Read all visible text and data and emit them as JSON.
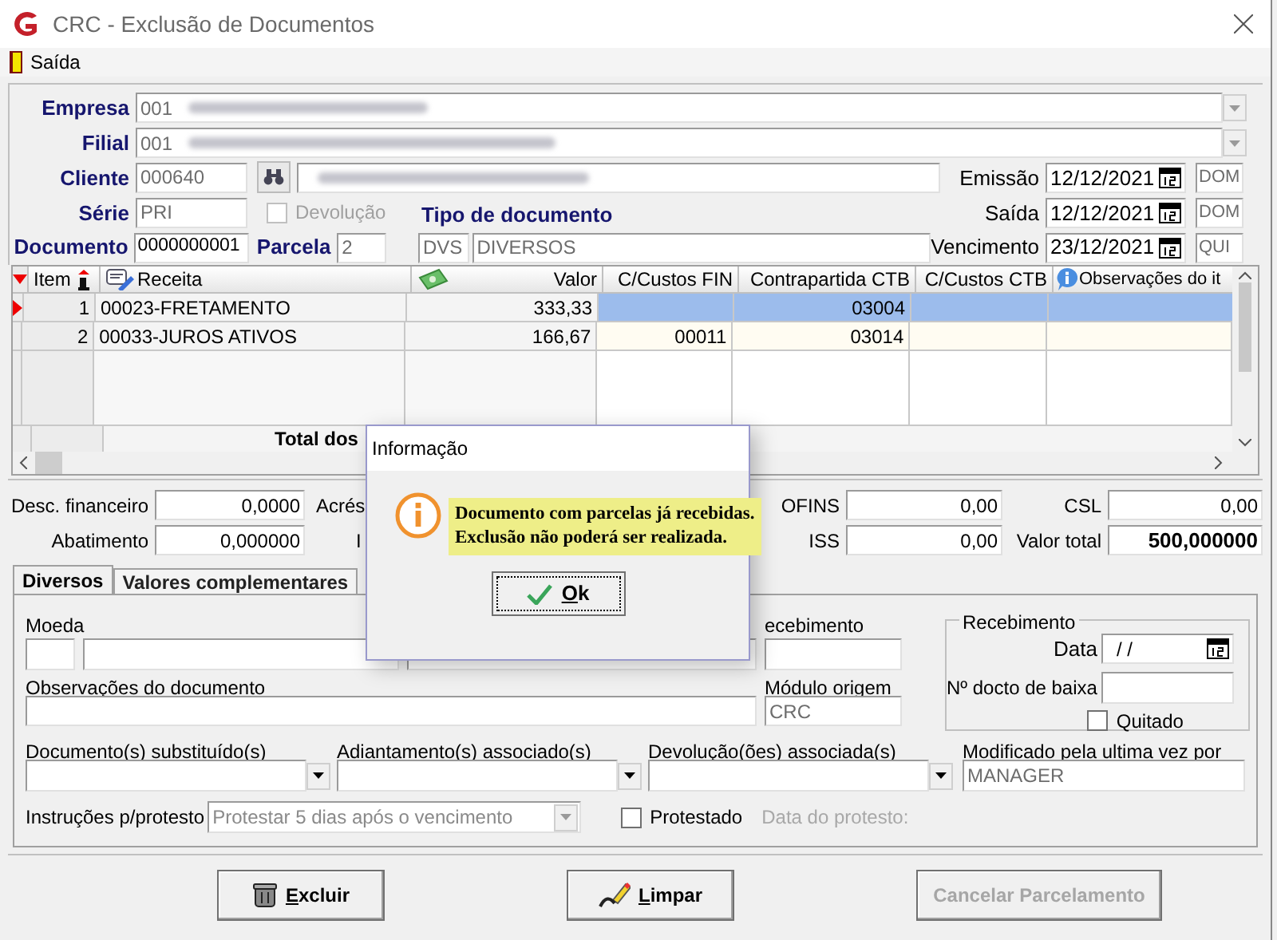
{
  "window": {
    "title": "CRC - Exclusão de Documentos"
  },
  "menu": [
    {
      "label": "Saída"
    }
  ],
  "header": {
    "empresa": {
      "label": "Empresa",
      "code": "001"
    },
    "filial": {
      "label": "Filial",
      "code": "001"
    },
    "cliente": {
      "label": "Cliente",
      "code": "000640"
    },
    "serie": {
      "label": "Série",
      "value": "PRI"
    },
    "devolucao": {
      "label": "Devolução",
      "checked": false,
      "disabled": true
    },
    "tipo_documento": {
      "label": "Tipo de documento",
      "code": "DVS",
      "name": "DIVERSOS"
    },
    "documento": {
      "label": "Documento",
      "value": "0000000001"
    },
    "parcela": {
      "label": "Parcela",
      "value": "2"
    },
    "dates": [
      {
        "label": "Emissão",
        "value": "12/12/2021",
        "day": "DOM"
      },
      {
        "label": "Saída",
        "value": "12/12/2021",
        "day": "DOM"
      },
      {
        "label": "Vencimento",
        "value": "23/12/2021",
        "day": "QUI"
      }
    ]
  },
  "grid": {
    "columns": [
      {
        "label": "Item"
      },
      {
        "label": "Receita"
      },
      {
        "label": "Valor"
      },
      {
        "label": "C/Custos FIN"
      },
      {
        "label": "Contrapartida CTB"
      },
      {
        "label": "C/Custos CTB"
      },
      {
        "label": "Observações do it"
      }
    ],
    "rows": [
      {
        "selected": true,
        "cells": [
          "1",
          "00023-FRETAMENTO",
          "333,33",
          null,
          "03004",
          null,
          null
        ]
      },
      {
        "selected": false,
        "cells": [
          "2",
          "00033-JUROS ATIVOS",
          "166,67",
          "00011",
          "03014",
          null,
          null
        ]
      }
    ],
    "total_label": "Total dos"
  },
  "totals": [
    [
      {
        "label": "Desc. financeiro",
        "value": "0,0000"
      },
      {
        "label": "Acrés"
      },
      {
        "label": "OFINS",
        "value": "0,00"
      },
      {
        "label": "CSL",
        "value": "0,00"
      }
    ],
    [
      {
        "label": "Abatimento",
        "value": "0,000000"
      },
      {
        "label": "I"
      },
      {
        "label": "ISS",
        "value": "0,00"
      },
      {
        "label": "Valor total",
        "value": "500,000000",
        "emphasis": true
      }
    ]
  ],
  "tabs": [
    {
      "label": "Diversos",
      "selected": true
    },
    {
      "label": "Valores complementares",
      "selected": false
    }
  ],
  "diversos": {
    "moeda": {
      "label": "Moeda"
    },
    "recebimento_field": {
      "label": "ecebimento"
    },
    "observacoes": {
      "label": "Observações do documento"
    },
    "modulo_origem": {
      "label": "Módulo origem",
      "value": "CRC"
    },
    "recebimento": {
      "title": "Recebimento",
      "data": {
        "label": "Data",
        "value": "/ /"
      },
      "nr_docto": {
        "label": "Nº docto de baixa"
      },
      "quitado": {
        "label": "Quitado",
        "checked": false
      }
    },
    "combos": [
      {
        "label": "Documento(s) substituído(s)"
      },
      {
        "label": "Adiantamento(s) associado(s)"
      },
      {
        "label": "Devolução(ões) associada(s)"
      }
    ],
    "modificado": {
      "label": "Modificado pela ultima vez por",
      "value": "MANAGER"
    },
    "instrucoes": {
      "label": "Instruções p/protesto",
      "value": "Protestar 5 dias após o vencimento",
      "disabled": true
    },
    "protestado": {
      "label": "Protestado",
      "checked": false
    },
    "data_protesto": {
      "label": "Data do protesto:",
      "disabled": true
    }
  },
  "buttons": [
    {
      "label": "Excluir",
      "disabled": false
    },
    {
      "label": "Limpar",
      "disabled": false
    },
    {
      "label": "Cancelar Parcelamento",
      "disabled": true
    }
  ],
  "dialog": {
    "title": "Informação",
    "lines": [
      "Documento com parcelas já recebidas.",
      "Exclusão não poderá ser realizada."
    ],
    "button": "Ok"
  }
}
